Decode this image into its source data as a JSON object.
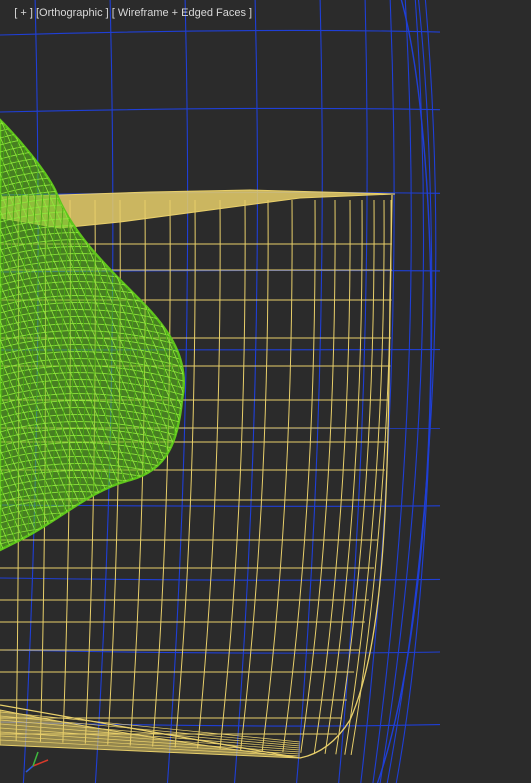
{
  "viewport": {
    "label_parts": [
      "[ + ] ",
      "[Orthographic ]",
      " [ Wireframe + Edged Faces ]"
    ],
    "view": "Orthographic",
    "shading": "Wireframe + Edged Faces"
  },
  "colors": {
    "background": "#2b2b2b",
    "blue_wire": "#1f3fd6",
    "yellow_wire": "#e8cf6a",
    "green_wire": "#5fc51c",
    "axis_x": "#d83a2a",
    "axis_y": "#3fb83f"
  },
  "objects": [
    {
      "name": "blue-sphere-mesh",
      "color": "blue"
    },
    {
      "name": "yellow-bowl-mesh",
      "color": "yellow"
    },
    {
      "name": "green-blob-mesh",
      "color": "green"
    }
  ],
  "axis_icon": "view-axis-tripod-icon"
}
